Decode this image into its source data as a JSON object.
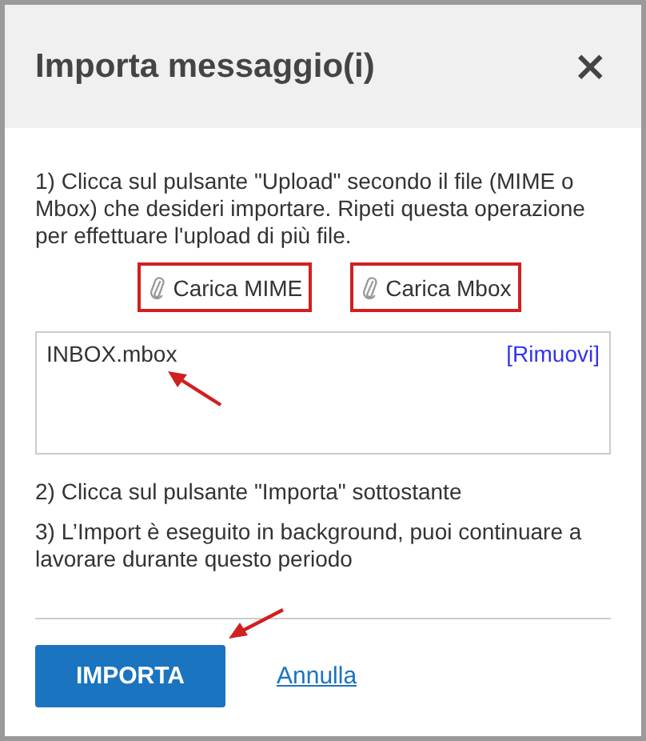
{
  "dialog": {
    "title": "Importa messaggio(i)",
    "close": "×"
  },
  "steps": [
    "1) Clicca sul pulsante \"Upload\" secondo il file (MIME o Mbox) che desideri importare. Ripeti questa operazione per effettuare l'upload di più file.",
    "2) Clicca sul pulsante \"Importa\" sottostante",
    "3) L’Import è eseguito in background, puoi continuare a lavorare durante questo periodo"
  ],
  "upload_buttons": [
    {
      "label": "Carica MIME",
      "highlighted": true
    },
    {
      "label": "Carica Mbox",
      "highlighted": true
    }
  ],
  "files": [
    {
      "name": "INBOX.mbox",
      "remove": "[Rimuovi]"
    }
  ],
  "buttons": {
    "primary": "IMPORTA",
    "cancel": "Annulla"
  }
}
